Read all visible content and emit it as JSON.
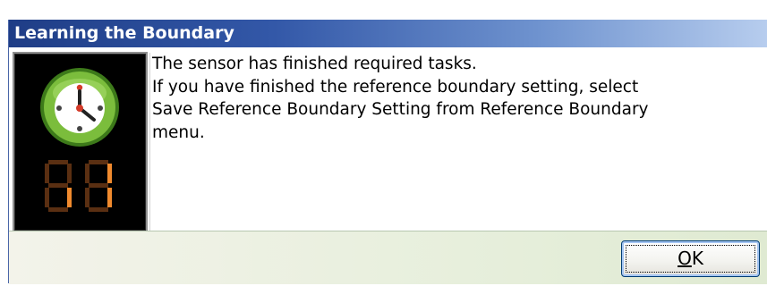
{
  "dialog": {
    "title": "Learning the Boundary",
    "message_lines": [
      "The sensor has finished required tasks.",
      "If you have finished the reference boundary setting, select",
      "Save Reference Boundary Setting from Reference Boundary",
      "menu."
    ],
    "ok_button": {
      "mnemonic": "O",
      "rest": "K"
    },
    "icon": "timer-clock-icon",
    "counter_display": "88"
  },
  "colors": {
    "titlebar_start": "#1f3d86",
    "titlebar_end": "#b7cdee",
    "clock_green": "#7bbd3c",
    "digit_orange": "#f08a2e",
    "digit_dim": "#5a2f12"
  }
}
